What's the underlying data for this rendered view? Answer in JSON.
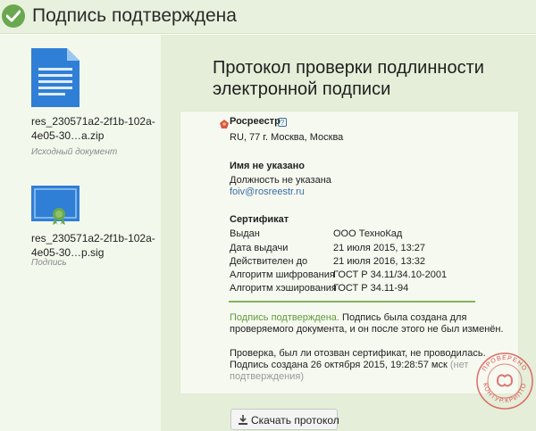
{
  "header": {
    "title": "Подпись подтверждена"
  },
  "files": [
    {
      "name": "res_230571a2-2f1b-102a-4e05-30…a.zip",
      "subtitle": "Исходный документ",
      "icon": "document-icon"
    },
    {
      "name": "res_230571a2-2f1b-102a-4e05-30…p.sig",
      "subtitle": "Подпись",
      "icon": "certificate-icon"
    }
  ],
  "protocol": {
    "title": "Протокол проверки подлинности электронной подписи",
    "issuer": {
      "name": "Росреестр",
      "help": "?",
      "address": "RU, 77 г. Москва, Москва"
    },
    "person": {
      "name": "Имя не указано",
      "position": "Должность не указана",
      "email": "foiv@rosreestr.ru"
    },
    "certificate": {
      "heading": "Сертификат",
      "rows": [
        {
          "label": "Выдан",
          "value": "ООО ТехноКад"
        },
        {
          "label": "Дата выдачи",
          "value": "21 июля 2015, 13:27"
        },
        {
          "label": "Действителен до",
          "value": "21 июля 2016, 13:32"
        },
        {
          "label": "Алгоритм шифрования",
          "value": "ГОСТ Р 34.11/34.10-2001"
        },
        {
          "label": "Алгоритм хэширования",
          "value": "ГОСТ Р 34.11-94"
        }
      ]
    },
    "result": {
      "status": "Подпись подтверждена.",
      "line1": "Подпись была создана для",
      "line2": "проверяемого документа, и он после этого не был изменён.",
      "revocation": "Проверка, был ли отозван сертификат, не проводилась.",
      "created": "Подпись создана 26 октября 2015, 19:28:57 мск",
      "created_note_a": "(нет",
      "created_note_b": "подтверждения)"
    },
    "stamp": {
      "top_text": "ПРОВЕРЕНО",
      "bottom_text": "КОНТУР.КРИПТО"
    }
  },
  "actions": {
    "download_label": "Скачать протокол"
  },
  "colors": {
    "accent_green": "#6aa84f",
    "link_blue": "#3a6ea5",
    "stamp_red": "#d9534f"
  }
}
